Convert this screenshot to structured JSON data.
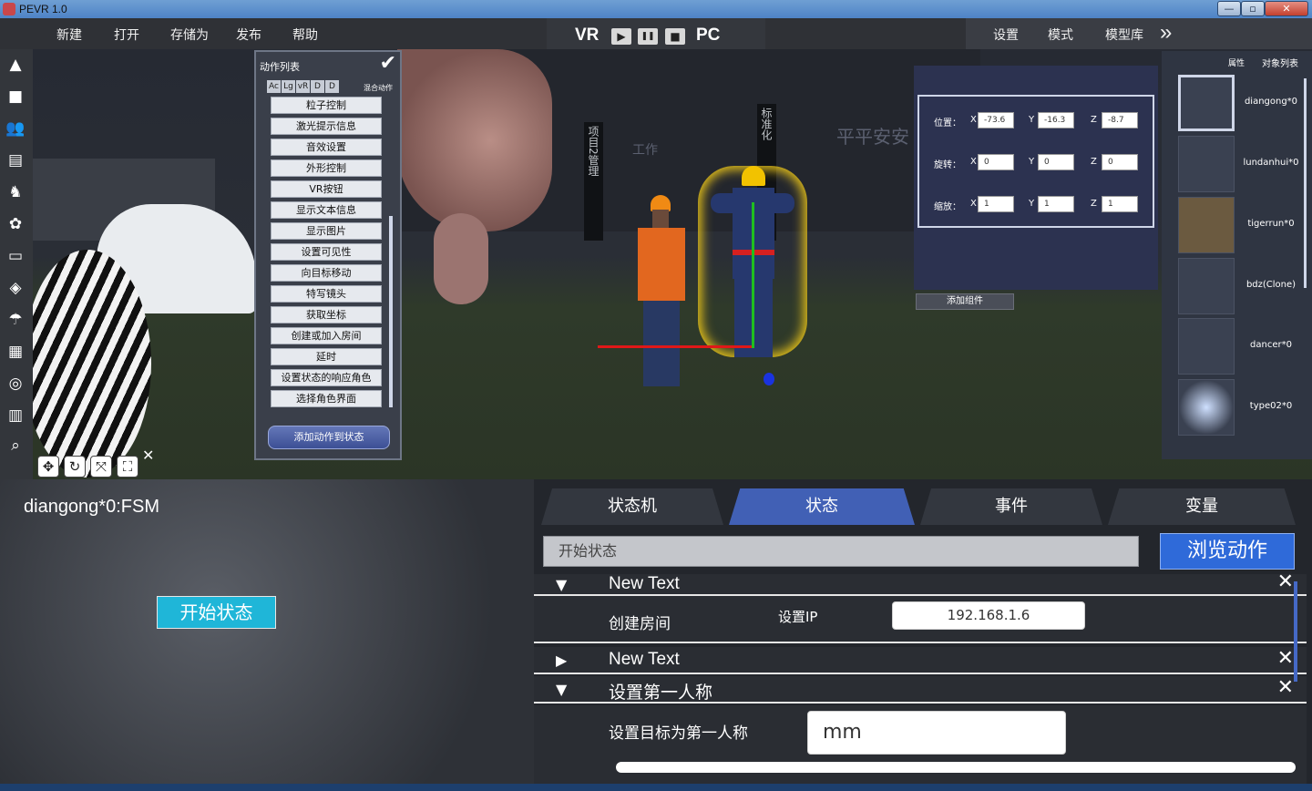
{
  "window": {
    "title": "PEVR 1.0",
    "controls": [
      "—",
      "▫",
      "✕"
    ]
  },
  "menu": {
    "items": [
      "新建",
      "打开",
      "存储为",
      "发布",
      "帮助"
    ]
  },
  "playbar": {
    "left": "VR",
    "right": "PC",
    "play": "▶",
    "pause": "❚❚",
    "stop": "■"
  },
  "rightmenu": {
    "items": [
      "设置",
      "模式",
      "模型库"
    ],
    "expand": "»"
  },
  "scene": {
    "signs": [
      "项目2管理",
      "标准化"
    ],
    "wall_text": "平平安安",
    "wall_text2": "工作"
  },
  "action_panel": {
    "title": "动作列表",
    "check": "✔",
    "tabs": [
      "Ac",
      "Lg",
      "vR",
      "D",
      "D"
    ],
    "mix": "混合动作",
    "items": [
      "粒子控制",
      "激光提示信息",
      "音效设置",
      "外形控制",
      "VR按钮",
      "显示文本信息",
      "显示图片",
      "设置可见性",
      "向目标移动",
      "特写镜头",
      "获取坐标",
      "创建或加入房间",
      "延时",
      "设置状态的响应角色",
      "选择角色界面"
    ],
    "add_button": "添加动作到状态"
  },
  "transform": {
    "rows": [
      {
        "label": "位置：",
        "x": "-73.6",
        "y": "-16.3",
        "z": "-8.7"
      },
      {
        "label": "旋转：",
        "x": "0",
        "y": "0",
        "z": "0"
      },
      {
        "label": "缩放：",
        "x": "1",
        "y": "1",
        "z": "1"
      }
    ],
    "axis": [
      "X",
      "Y",
      "Z"
    ],
    "add_component": "添加组件"
  },
  "object_panel": {
    "tabs": [
      "属性",
      "对象列表"
    ],
    "items": [
      "diangong*0",
      "lundanhui*0",
      "tigerrun*0",
      "bdz(Clone)",
      "dancer*0",
      "type02*0"
    ]
  },
  "gizmo": {
    "buttons": [
      "✥",
      "↻",
      "⤧",
      "⛶"
    ],
    "close": "✕"
  },
  "fsm": {
    "label": "diangong*0:FSM",
    "node": "开始状态"
  },
  "state_panel": {
    "tabs": [
      "状态机",
      "状态",
      "事件",
      "变量"
    ],
    "active_tab": 1,
    "state_name": "开始状态",
    "browse": "浏览动作",
    "rows": [
      {
        "arrow": "▼",
        "title": "New Text"
      },
      {
        "arrow": "▶",
        "title": "New Text"
      },
      {
        "arrow": "▼",
        "title": "设置第一人称"
      }
    ],
    "create_room": {
      "label": "创建房间",
      "ip_label": "设置IP",
      "ip_value": "192.168.1.6"
    },
    "first_person": {
      "label": "设置目标为第一人称",
      "value": "mm"
    },
    "close": "✕"
  }
}
